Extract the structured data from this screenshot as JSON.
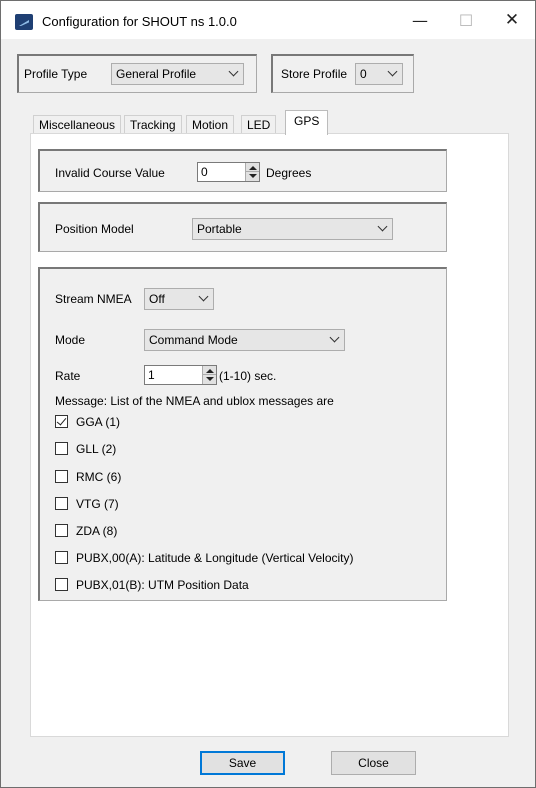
{
  "window": {
    "title": "Configuration for SHOUT ns 1.0.0",
    "minimize": "—",
    "maximize": "☐",
    "close": "✕"
  },
  "profile": {
    "type_label": "Profile Type",
    "type_value": "General Profile",
    "store_label": "Store Profile",
    "store_value": "0"
  },
  "tabs": [
    {
      "label": "Miscellaneous"
    },
    {
      "label": "Tracking"
    },
    {
      "label": "Motion"
    },
    {
      "label": "LED"
    },
    {
      "label": "GPS"
    }
  ],
  "gps": {
    "invalid_course": {
      "label": "Invalid Course Value",
      "value": "0",
      "unit": "Degrees"
    },
    "position_model": {
      "label": "Position Model",
      "value": "Portable"
    },
    "stream_nmea": {
      "label": "Stream NMEA",
      "value": "Off"
    },
    "mode": {
      "label": "Mode",
      "value": "Command Mode"
    },
    "rate": {
      "label": "Rate",
      "value": "1",
      "unit": "(1-10) sec."
    },
    "message_label": "Message:  List of the NMEA and ublox messages are",
    "messages": [
      {
        "label": "GGA (1)",
        "checked": true
      },
      {
        "label": "GLL (2)",
        "checked": false
      },
      {
        "label": "RMC (6)",
        "checked": false
      },
      {
        "label": "VTG (7)",
        "checked": false
      },
      {
        "label": "ZDA (8)",
        "checked": false
      },
      {
        "label": "PUBX,00(A): Latitude & Longitude (Vertical Velocity)",
        "checked": false
      },
      {
        "label": "PUBX,01(B): UTM Position Data",
        "checked": false
      }
    ]
  },
  "buttons": {
    "save": "Save",
    "close": "Close"
  }
}
